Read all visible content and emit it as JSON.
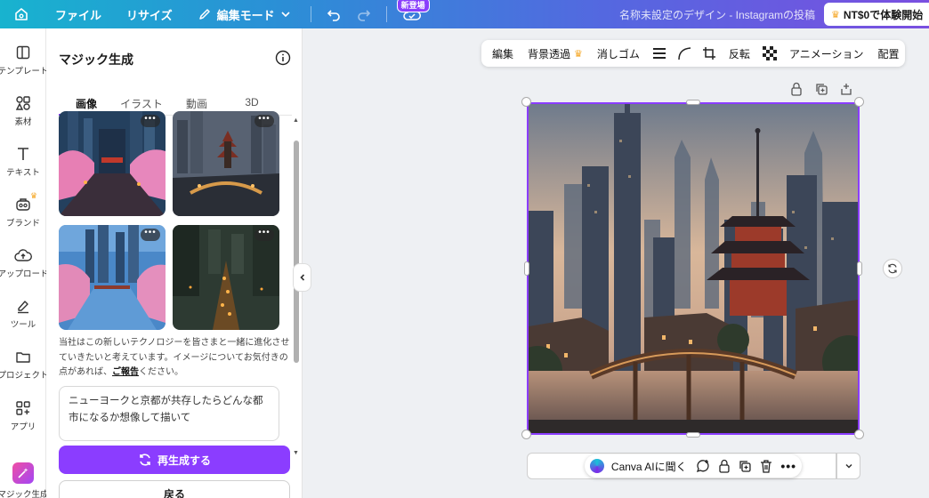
{
  "topbar": {
    "file": "ファイル",
    "resize": "リサイズ",
    "edit_mode": "編集モード",
    "new_badge": "新登場",
    "doc_title": "名称未設定のデザイン - Instagramの投稿",
    "trial": "NT$0で体験開始"
  },
  "rail": {
    "template": "テンプレート",
    "elements": "素材",
    "text": "テキスト",
    "brand": "ブランド",
    "upload": "アップロード",
    "tools": "ツール",
    "projects": "プロジェクト",
    "apps": "アプリ",
    "magic": "マジック生成"
  },
  "panel": {
    "title": "マジック生成",
    "tabs": [
      "画像",
      "イラスト",
      "動画",
      "3D"
    ],
    "active_tab": "画像",
    "note_text": "当社はこの新しいテクノロジーを皆さまと一緒に進化させていきたいと考えています。イメージについてお気付きの点があれば、",
    "note_link": "ご報告",
    "note_end": "ください。",
    "prompt": "ニューヨークと京都が共存したらどんな都市になるか想像して描いて",
    "regenerate": "再生成する",
    "back": "戻る"
  },
  "toolbar": {
    "edit": "編集",
    "bg_remove": "背景透過",
    "eraser": "消しゴム",
    "flip": "反転",
    "animate": "アニメーション",
    "position": "配置"
  },
  "bottom": {
    "ai_ask": "Canva AIに聞く"
  },
  "colors": {
    "accent": "#8b3dff",
    "crown": "#f5a623"
  }
}
